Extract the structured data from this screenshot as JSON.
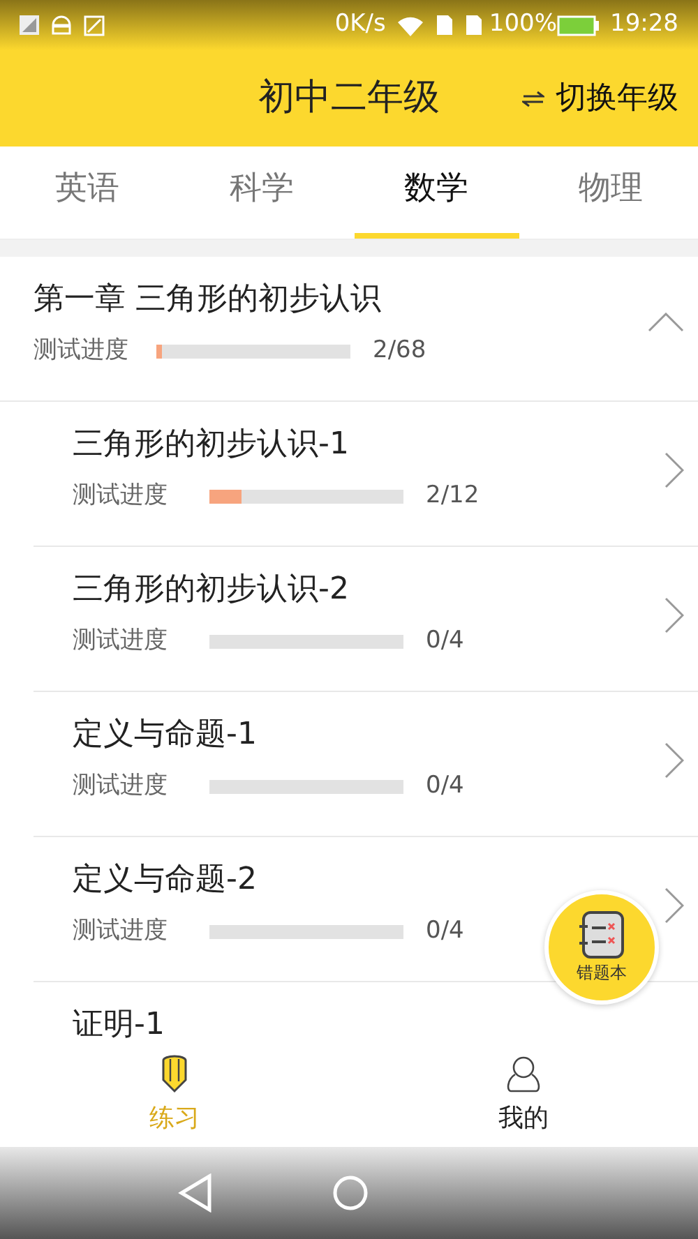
{
  "status_bar": {
    "speed": "0K/s",
    "battery": "100%",
    "time": "19:28"
  },
  "header": {
    "title": "初中二年级",
    "switch_label": "切换年级"
  },
  "tabs": [
    {
      "label": "英语",
      "selected": false
    },
    {
      "label": "科学",
      "selected": false
    },
    {
      "label": "数学",
      "selected": true
    },
    {
      "label": "物理",
      "selected": false
    }
  ],
  "chapter": {
    "title": "第一章 三角形的初步认识",
    "expanded": true,
    "progress_label": "测试进度",
    "level": 0.03,
    "reading": "2/68",
    "sections": [
      {
        "title": "三角形的初步认识-1",
        "progress_label": "测试进度",
        "level": 0.167,
        "reading": "2/12"
      },
      {
        "title": "三角形的初步认识-2",
        "progress_label": "测试进度",
        "level": 0,
        "reading": "0/4"
      },
      {
        "title": "定义与命题-1",
        "progress_label": "测试进度",
        "level": 0,
        "reading": "0/4"
      },
      {
        "title": "定义与命题-2",
        "progress_label": "测试进度",
        "level": 0,
        "reading": "0/4"
      },
      {
        "title": "证明-1"
      }
    ]
  },
  "fab": {
    "label": "错题本"
  },
  "bottom_nav": [
    {
      "label": "练习",
      "selected": true
    },
    {
      "label": "我的",
      "selected": false
    }
  ]
}
